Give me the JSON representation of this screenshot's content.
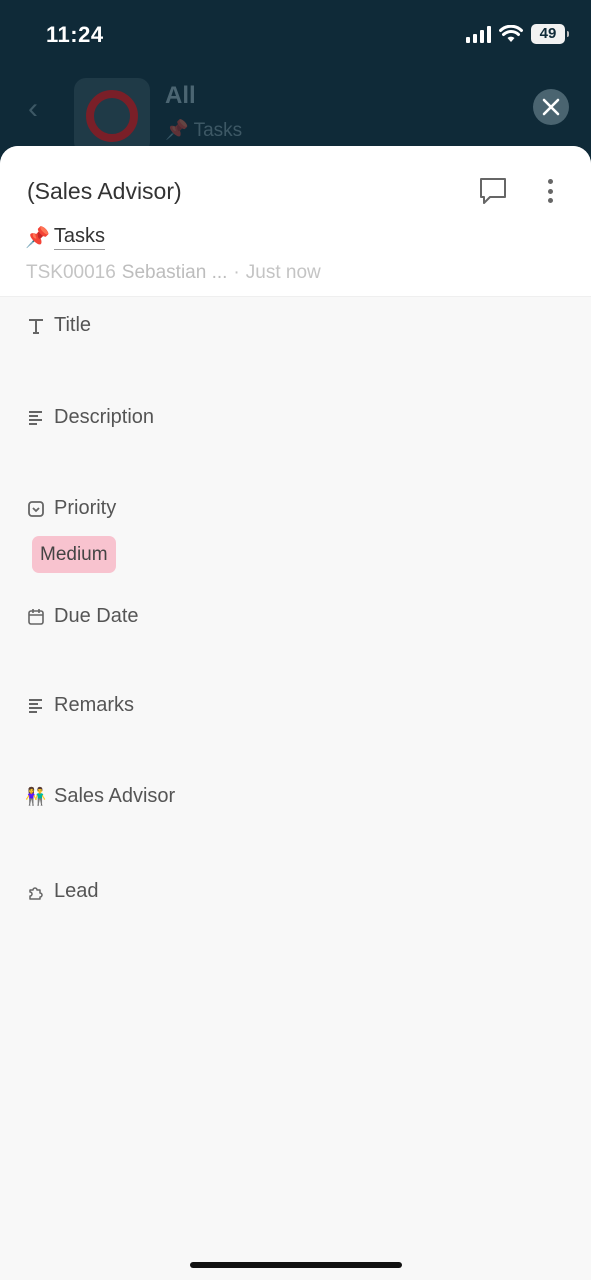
{
  "status_bar": {
    "time": "11:24",
    "battery": "49"
  },
  "background_header": {
    "title": "All",
    "subtitle": "Tasks"
  },
  "record": {
    "title": "(Sales Advisor)",
    "table_name": "Tasks",
    "record_id": "TSK00016",
    "creator": "Sebastian ...",
    "separator": "·",
    "updated": "Just now"
  },
  "fields": [
    {
      "label": "Title",
      "icon": "text-icon"
    },
    {
      "label": "Description",
      "icon": "lines-icon"
    },
    {
      "label": "Priority",
      "icon": "select-icon",
      "value": "Medium",
      "value_color": "#f8c3cf"
    },
    {
      "label": "Due Date",
      "icon": "calendar-icon"
    },
    {
      "label": "Remarks",
      "icon": "lines-icon"
    },
    {
      "label": "Sales Advisor",
      "icon": "people-icon"
    },
    {
      "label": "Lead",
      "icon": "puzzle-icon"
    }
  ],
  "colors": {
    "header_bg": "#0f2a38",
    "sheet_bg": "#f8f8f8",
    "chip": "#f8c3cf"
  }
}
